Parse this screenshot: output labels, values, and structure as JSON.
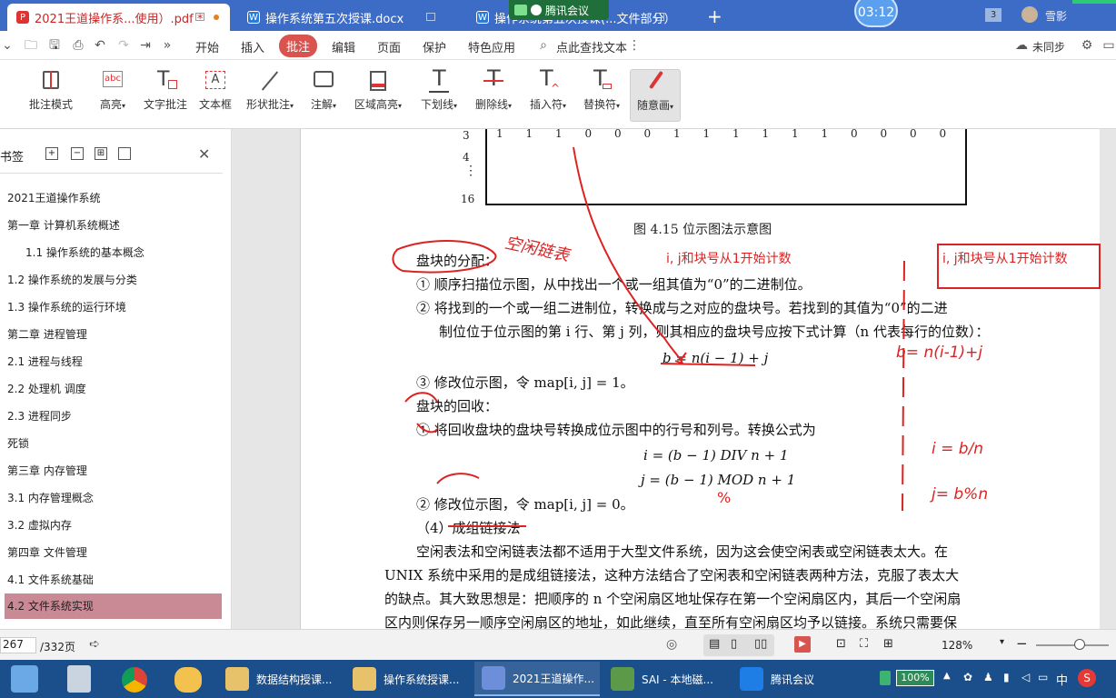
{
  "tabs": [
    {
      "label": "2021王道操作系...使用）.pdf *",
      "icon": "pdf-icon",
      "active": true
    },
    {
      "label": "操作系统第五次授课.docx",
      "icon": "word-icon",
      "active": false
    },
    {
      "label": "操作系统第五次授课(...文件部分）",
      "icon": "word-icon",
      "active": false
    }
  ],
  "meeting_overlay": {
    "label": "腾讯会议",
    "timer": "03:12"
  },
  "account": {
    "count": "3",
    "name": "雪影"
  },
  "menu": {
    "items": [
      "开始",
      "插入",
      "批注",
      "编辑",
      "页面",
      "保护",
      "特色应用"
    ],
    "active": "批注",
    "search": "点此查找文本",
    "sync": "未同步"
  },
  "ribbon": [
    {
      "label": "批注模式",
      "icon": "annotation-mode-icon"
    },
    {
      "label": "高亮",
      "icon": "highlight-icon",
      "dropdown": true
    },
    {
      "label": "文字批注",
      "icon": "text-annotation-icon"
    },
    {
      "label": "文本框",
      "icon": "textbox-icon"
    },
    {
      "label": "形状批注",
      "icon": "shape-annotation-icon",
      "dropdown": true
    },
    {
      "label": "注解",
      "icon": "comment-icon",
      "dropdown": true
    },
    {
      "label": "区域高亮",
      "icon": "area-highlight-icon",
      "dropdown": true
    },
    {
      "label": "下划线",
      "icon": "underline-icon",
      "dropdown": true
    },
    {
      "label": "删除线",
      "icon": "strikethrough-icon",
      "dropdown": true
    },
    {
      "label": "插入符",
      "icon": "insert-caret-icon",
      "dropdown": true
    },
    {
      "label": "替换符",
      "icon": "replace-icon",
      "dropdown": true
    },
    {
      "label": "随意画",
      "icon": "freehand-pen-icon",
      "dropdown": true,
      "selected": true
    }
  ],
  "sidebar": {
    "title": "书签",
    "items": [
      {
        "label": "2021王道操作系统",
        "level": 0
      },
      {
        "label": "第一章 计算机系统概述",
        "level": 0
      },
      {
        "label": "1.1 操作系统的基本概念",
        "level": 1
      },
      {
        "label": "1.2 操作系统的发展与分类",
        "level": 0
      },
      {
        "label": "1.3 操作系统的运行环境",
        "level": 0
      },
      {
        "label": "第二章  进程管理",
        "level": 0
      },
      {
        "label": "2.1 进程与线程",
        "level": 0
      },
      {
        "label": "2.2 处理机 调度",
        "level": 0
      },
      {
        "label": "2.3 进程同步",
        "level": 0
      },
      {
        "label": "死锁",
        "level": 0
      },
      {
        "label": "第三章 内存管理",
        "level": 0
      },
      {
        "label": "3.1 内存管理概念",
        "level": 0
      },
      {
        "label": "3.2 虚拟内存",
        "level": 0
      },
      {
        "label": "第四章 文件管理",
        "level": 0
      },
      {
        "label": "4.1 文件系统基础",
        "level": 0
      },
      {
        "label": "4.2 文件系统实现",
        "level": 0,
        "active": true
      }
    ]
  },
  "document": {
    "bitmap_rows": [
      {
        "row": "3",
        "bits": [
          "1",
          "1",
          "1",
          "0",
          "0",
          "0",
          "1",
          "1",
          "1",
          "1",
          "1",
          "1",
          "0",
          "0",
          "0",
          "0"
        ]
      },
      {
        "row": "4",
        "bits": []
      },
      {
        "row": "⋮",
        "bits": []
      },
      {
        "row": "16",
        "bits": []
      }
    ],
    "caption": "图 4.15   位示图法示意图",
    "alloc_title": "盘块的分配：",
    "alloc_1": "①  顺序扫描位示图，从中找出一个或一组其值为“0”的二进制位。",
    "alloc_2a": "②  将找到的一个或一组二进制位，转换成与之对应的盘块号。若找到的其值为“0”的二进",
    "alloc_2b": "制位位于位示图的第 i 行、第 j 列，则其相应的盘块号应按下式计算（n 代表每行的位数）：",
    "formula_b": "b = n(i − 1) + j",
    "alloc_3": "③  修改位示图，令 map[i, j] = 1。",
    "recycle_title": "盘块的回收：",
    "recycle_1": "①  将回收盘块的盘块号转换成位示图中的行号和列号。转换公式为",
    "formula_i": "i = (b − 1) DIV n + 1",
    "formula_j": "j = (b − 1) MOD n + 1",
    "recycle_2": "②  修改位示图，令 map[i, j] = 0。",
    "section_4": "（4）成组链接法",
    "para_1": "空闲表法和空闲链表法都不适用于大型文件系统，因为这会使空闲表或空闲链表太大。在",
    "para_2": "UNIX 系统中采用的是成组链接法，这种方法结合了空闲表和空闲链表两种方法，克服了表太大",
    "para_3": "的缺点。其大致思想是：把顺序的 n 个空闲扇区地址保存在第一个空闲扇区内，其后一个空闲扇",
    "para_4": "区内则保存另一顺序空闲扇区的地址，如此继续，直至所有空闲扇区均予以链接。系统只需要保"
  },
  "annotations": {
    "note_free_chain": "空闲链表",
    "note_index_1": "i, j和块号从1开始计数",
    "note_index_2": "i, j和块号从1开始计数",
    "formula_b_handwritten": "b= n(i-1)+j",
    "formula_i_handwritten": "i = b/n",
    "formula_j_handwritten": "j= b%n",
    "mod_mark": "%"
  },
  "statusbar": {
    "page": "267",
    "total": "/332页",
    "zoom": "128%"
  },
  "taskbar": {
    "apps": [
      {
        "label": "数据结构授课...",
        "icon": "folder-icon"
      },
      {
        "label": "操作系统授课...",
        "icon": "folder-icon"
      },
      {
        "label": "2021王道操作...",
        "icon": "wps-pdf-icon"
      },
      {
        "label": "SAI - 本地磁...",
        "icon": "sai-icon"
      },
      {
        "label": "腾讯会议",
        "icon": "tencent-meeting-icon"
      }
    ],
    "battery": "100%",
    "ime": "中"
  },
  "colors": {
    "tabbar": "#3d6cc7",
    "accent_red": "#d9534f",
    "ink": "#d22222",
    "taskbar": "#1b4f8c",
    "bookmark_active": "#c98a95"
  }
}
